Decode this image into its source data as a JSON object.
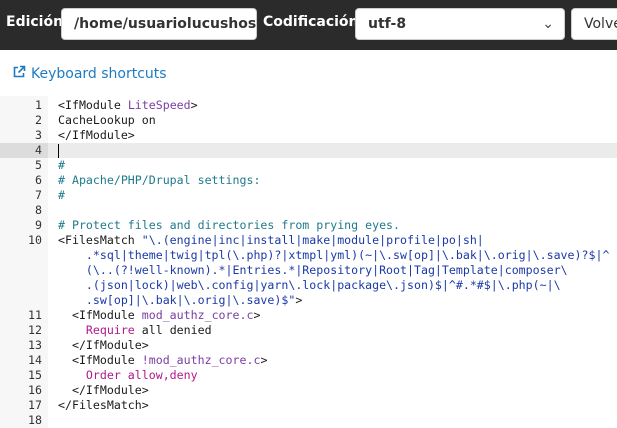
{
  "toolbar": {
    "edition_label": "Edición:",
    "path_value": "/home/usuariolucushos",
    "encoding_label": "Codificación:",
    "encoding_value": "utf-8",
    "return_button": "Volve"
  },
  "shortcuts": {
    "label": "Keyboard shortcuts"
  },
  "editor": {
    "lines": [
      {
        "n": "1",
        "segments": [
          {
            "t": "<IfModule ",
            "c": "kw"
          },
          {
            "t": "LiteSpeed",
            "c": "attr"
          },
          {
            "t": ">",
            "c": "kw"
          }
        ]
      },
      {
        "n": "2",
        "segments": [
          {
            "t": "CacheLookup on",
            "c": "kw"
          }
        ]
      },
      {
        "n": "3",
        "segments": [
          {
            "t": "</IfModule>",
            "c": "kw"
          }
        ]
      },
      {
        "n": "4",
        "segments": []
      },
      {
        "n": "5",
        "segments": [
          {
            "t": "#",
            "c": "cmt"
          }
        ]
      },
      {
        "n": "6",
        "segments": [
          {
            "t": "# Apache/PHP/Drupal settings:",
            "c": "cmt"
          }
        ]
      },
      {
        "n": "7",
        "segments": [
          {
            "t": "#",
            "c": "cmt"
          }
        ]
      },
      {
        "n": "8",
        "segments": []
      },
      {
        "n": "9",
        "segments": [
          {
            "t": "# Protect files and directories from prying eyes.",
            "c": "cmt"
          }
        ]
      },
      {
        "n": "10",
        "segments": [
          {
            "t": "<FilesMatch ",
            "c": "kw"
          },
          {
            "t": "\"\\.(engine|inc|install|make|module|profile|po|sh|",
            "c": "str"
          }
        ]
      },
      {
        "n": "",
        "segments": [
          {
            "t": "    .*sql|theme|twig|tpl(\\.php)?|xtmpl|yml)(~|\\.sw[op]|\\.bak|\\.orig|\\.save)?$|^",
            "c": "str"
          }
        ]
      },
      {
        "n": "",
        "segments": [
          {
            "t": "    (\\..(?!well-known).*|Entries.*|Repository|Root|Tag|Template|composer\\",
            "c": "str"
          }
        ]
      },
      {
        "n": "",
        "segments": [
          {
            "t": "    .(json|lock)|web\\.config|yarn\\.lock|package\\.json)$|^#.*#$|\\.php(~|\\",
            "c": "str"
          }
        ]
      },
      {
        "n": "",
        "segments": [
          {
            "t": "    .sw[op]|\\.bak|\\.orig|\\.save)$\"",
            "c": "str"
          },
          {
            "t": ">",
            "c": "kw"
          }
        ]
      },
      {
        "n": "11",
        "segments": [
          {
            "t": "  <IfModule ",
            "c": "kw"
          },
          {
            "t": "mod_authz_core.c",
            "c": "attr"
          },
          {
            "t": ">",
            "c": "kw"
          }
        ]
      },
      {
        "n": "12",
        "segments": [
          {
            "t": "    ",
            "c": "kw"
          },
          {
            "t": "Require",
            "c": "dir"
          },
          {
            "t": " all denied",
            "c": "kw"
          }
        ]
      },
      {
        "n": "13",
        "segments": [
          {
            "t": "  </IfModule>",
            "c": "kw"
          }
        ]
      },
      {
        "n": "14",
        "segments": [
          {
            "t": "  <IfModule ",
            "c": "kw"
          },
          {
            "t": "!mod_authz_core.c",
            "c": "attr"
          },
          {
            "t": ">",
            "c": "kw"
          }
        ]
      },
      {
        "n": "15",
        "segments": [
          {
            "t": "    ",
            "c": "kw"
          },
          {
            "t": "Order allow,deny",
            "c": "dir"
          }
        ]
      },
      {
        "n": "16",
        "segments": [
          {
            "t": "  </IfModule>",
            "c": "kw"
          }
        ]
      },
      {
        "n": "17",
        "segments": [
          {
            "t": "</FilesMatch>",
            "c": "kw"
          }
        ]
      },
      {
        "n": "18",
        "segments": []
      }
    ]
  },
  "colors": {
    "toolbar_bg": "#2b2b2b",
    "link": "#1f7bc1",
    "comment": "#1f7a8c",
    "directive": "#b0188c",
    "attribute": "#7a3ea1",
    "string": "#1b3aa6"
  }
}
